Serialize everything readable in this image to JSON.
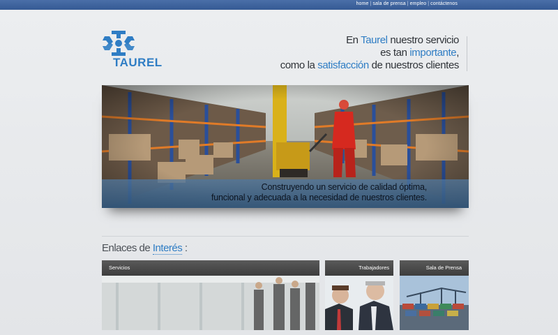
{
  "topnav": {
    "links": [
      "home",
      "sala de prensa",
      "empleo",
      "contáctenos"
    ],
    "separator": "|"
  },
  "logo": {
    "text": "TAUREL"
  },
  "tagline": {
    "line1_a": "En ",
    "line1_b": "Taurel",
    "line1_c": " nuestro servicio",
    "line2_a": "es tan ",
    "line2_b": "importante",
    "line2_c": ",",
    "line3_a": "como la ",
    "line3_b": "satisfacción",
    "line3_c": " de nuestros clientes"
  },
  "hero": {
    "caption_line1": "Construyendo un servicio de calidad óptima,",
    "caption_line2": "funcional y adecuada a la necesidad de nuestros clientes."
  },
  "section": {
    "title_a": "Enlaces de ",
    "title_b": "Interés",
    "title_c": " :"
  },
  "cards": {
    "servicios": "Servicios",
    "trabajadores": "Trabajadores",
    "prensa": "Sala de Prensa"
  },
  "colors": {
    "accent": "#2f7dc4",
    "topbar": "#3d62a0"
  }
}
